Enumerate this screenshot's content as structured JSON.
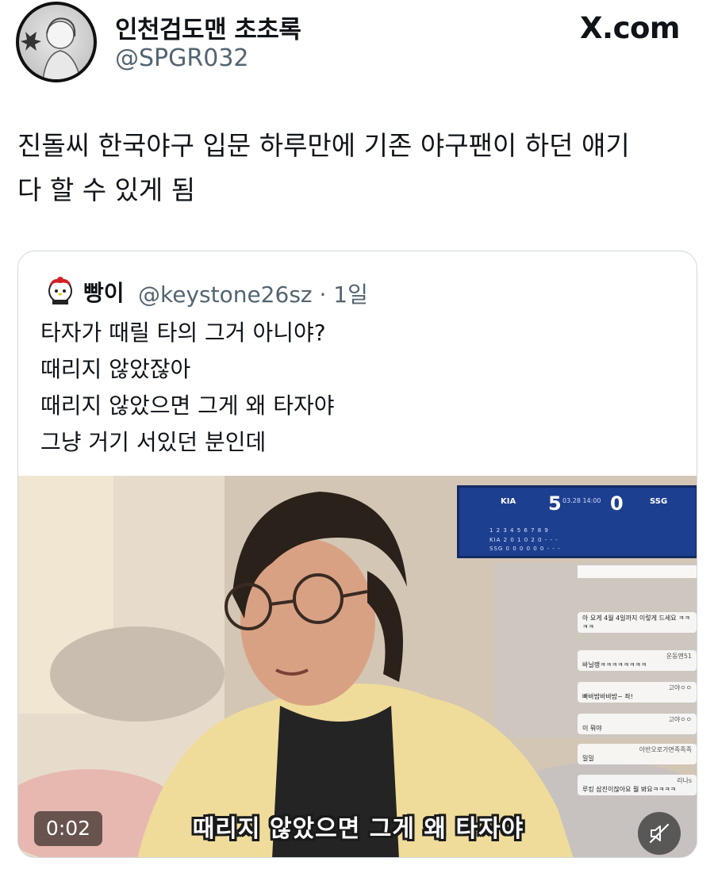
{
  "author": {
    "display_name": "인천검도맨 초초록",
    "handle": "@SPGR032"
  },
  "brand": {
    "label": "X.com"
  },
  "tweet": {
    "line1": "진돌씨 한국야구 입문 하루만에 기존 야구팬이 하던 얘기",
    "line2": "다 할 수 있게 됨"
  },
  "quote": {
    "display_name": "빵이",
    "handle_time": "@keystone26sz · 1일",
    "lines": [
      "타자가 때릴 타의 그거 아니야?",
      "때리지 않았잖아",
      "때리지 않았으면 그게 왜 타자야",
      "그냥 거기 서있던 분인데"
    ]
  },
  "video": {
    "subtitle": "때리지 않았으면 그게 왜 타자야",
    "time": "0:02",
    "muted": true,
    "scoreboard": {
      "home_team": "KIA",
      "home_score": "5",
      "away_team": "SSG",
      "away_score": "0",
      "datetime": "03.28 14:00",
      "innings": "1  2  3  4  5  6  7  8  9",
      "kia_line": "KIA  2  0  1  0  2  0  -  -  -",
      "ssg_line": "SSG  0  0  0  0  0  0  -  -  -"
    },
    "chat": [
      {
        "user": "",
        "msg": "아 요게 4월 4일까지 이렇게 드세요 ㅋㅋㅋㅋ"
      },
      {
        "user": "운동맨51",
        "msg": "바닐랭ㅋㅋㅋㅋㅋㅋㅋㅋ"
      },
      {
        "user": "고야ㅇㅇ",
        "msg": "빠바밤바바밤~ 좌!"
      },
      {
        "user": "고야ㅇㅇ",
        "msg": "이 뭐야"
      },
      {
        "user": "아반오로가면족족족",
        "msg": "밀밀"
      },
      {
        "user": "리나s",
        "msg": "루킹 삼진이잖아요 뭘 봐요ㅋㅋㅋㅋ"
      }
    ]
  }
}
